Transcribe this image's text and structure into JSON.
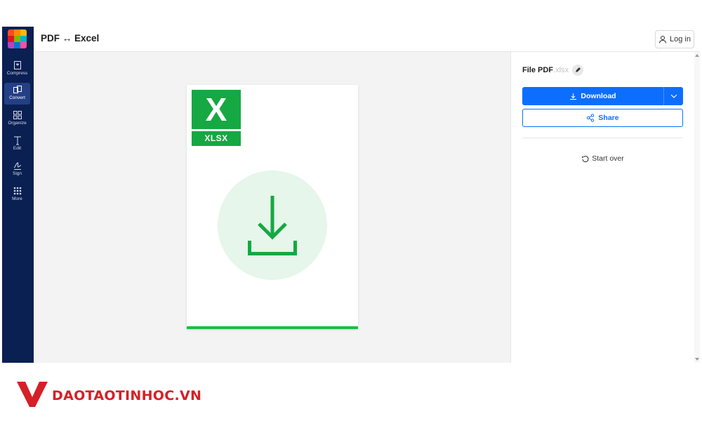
{
  "app": {
    "title": "PDF ↔ Excel",
    "login_label": "Log in"
  },
  "sidebar": {
    "items": [
      {
        "label": "Compress",
        "icon": "compress-icon"
      },
      {
        "label": "Convert",
        "icon": "convert-icon",
        "active": true
      },
      {
        "label": "Organize",
        "icon": "organize-icon"
      },
      {
        "label": "Edit",
        "icon": "edit-text-icon"
      },
      {
        "label": "Sign",
        "icon": "signature-icon"
      },
      {
        "label": "More",
        "icon": "more-grid-icon"
      }
    ],
    "logo_colors": [
      "#f25022",
      "#ff8c00",
      "#ffb900",
      "#e81123",
      "#7fba00",
      "#00b7c3",
      "#b146c2",
      "#0078d7",
      "#ff4fa1"
    ]
  },
  "preview": {
    "file_badge_letter": "X",
    "file_badge_label": "XLSX",
    "icon": "download-icon"
  },
  "panel": {
    "file_name": "File PDF",
    "file_ext": ".xlsx",
    "download_label": "Download",
    "share_label": "Share",
    "start_over_label": "Start over"
  },
  "watermark": {
    "text": "DAOTAOTINHOC.VN"
  },
  "colors": {
    "sidebar_bg": "#0a1f52",
    "accent_blue": "#0d6efd",
    "excel_green": "#16a843",
    "progress_green": "#18c23d",
    "watermark_red": "#d61f26"
  }
}
